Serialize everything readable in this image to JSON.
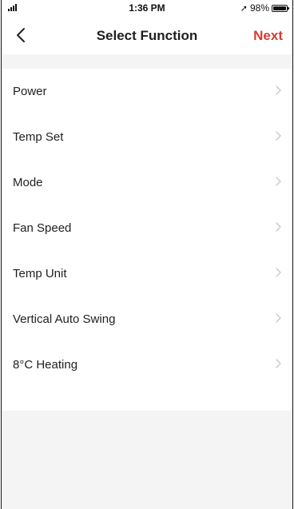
{
  "status_bar": {
    "time": "1:36 PM",
    "battery_percent": "98%",
    "location_arrow": "➚"
  },
  "nav": {
    "title": "Select Function",
    "next_label": "Next",
    "accent_color": "#d63c34"
  },
  "functions": [
    {
      "label": "Power"
    },
    {
      "label": "Temp Set"
    },
    {
      "label": "Mode"
    },
    {
      "label": "Fan Speed"
    },
    {
      "label": "Temp Unit"
    },
    {
      "label": "Vertical Auto Swing"
    },
    {
      "label": "8°C Heating"
    }
  ]
}
